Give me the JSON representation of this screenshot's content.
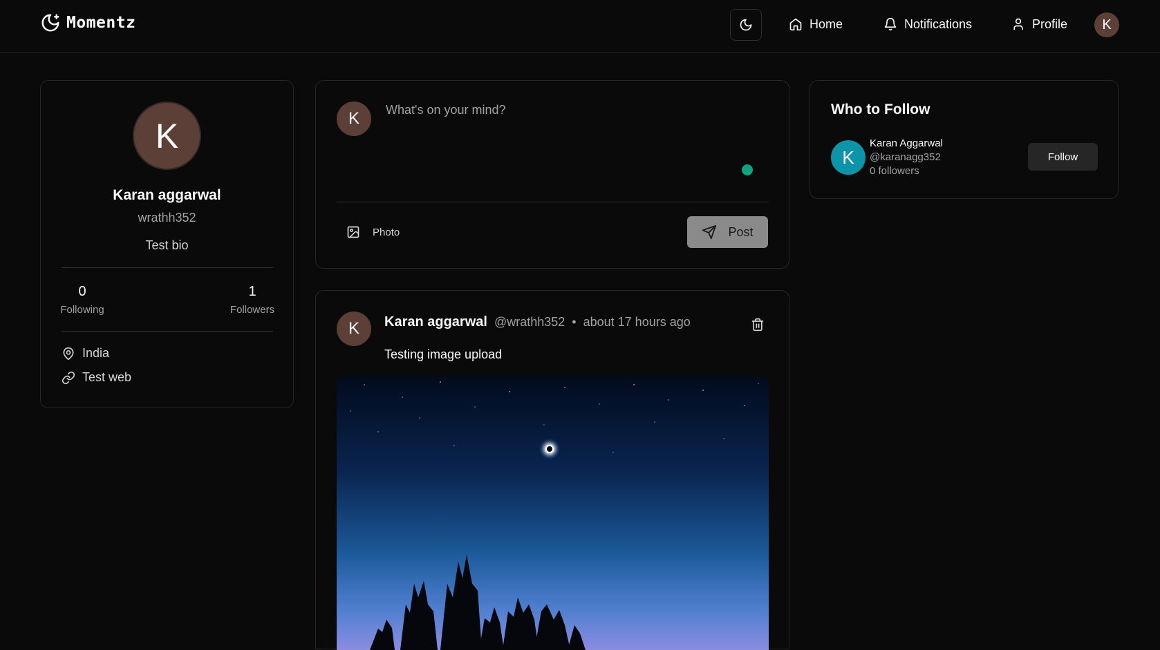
{
  "header": {
    "brand": "Momentz",
    "nav": {
      "home": "Home",
      "notifications": "Notifications",
      "profile": "Profile"
    },
    "avatar_initial": "K"
  },
  "profile": {
    "initial": "K",
    "name": "Karan aggarwal",
    "username": "wrathh352",
    "bio": "Test bio",
    "following_count": "0",
    "following_label": "Following",
    "followers_count": "1",
    "followers_label": "Followers",
    "location": "India",
    "website": "Test web"
  },
  "composer": {
    "initial": "K",
    "placeholder": "What's on your mind?",
    "photo_label": "Photo",
    "post_label": "Post"
  },
  "post": {
    "initial": "K",
    "author_name": "Karan aggarwal",
    "author_handle": "@wrathh352",
    "separator": "•",
    "timestamp": "about 17 hours ago",
    "content": "Testing image upload"
  },
  "who_to_follow": {
    "title": "Who to Follow",
    "users": [
      {
        "initial": "K",
        "name": "Karan Aggarwal",
        "handle": "@karanagg352",
        "followers": "0 followers",
        "button": "Follow"
      }
    ]
  },
  "colors": {
    "background": "#0a0a0a",
    "border": "#262626",
    "avatar_brown": "#5c4038",
    "avatar_teal": "#0e94a8",
    "online_green": "#10a37f",
    "post_button": "#8a8a8a"
  }
}
